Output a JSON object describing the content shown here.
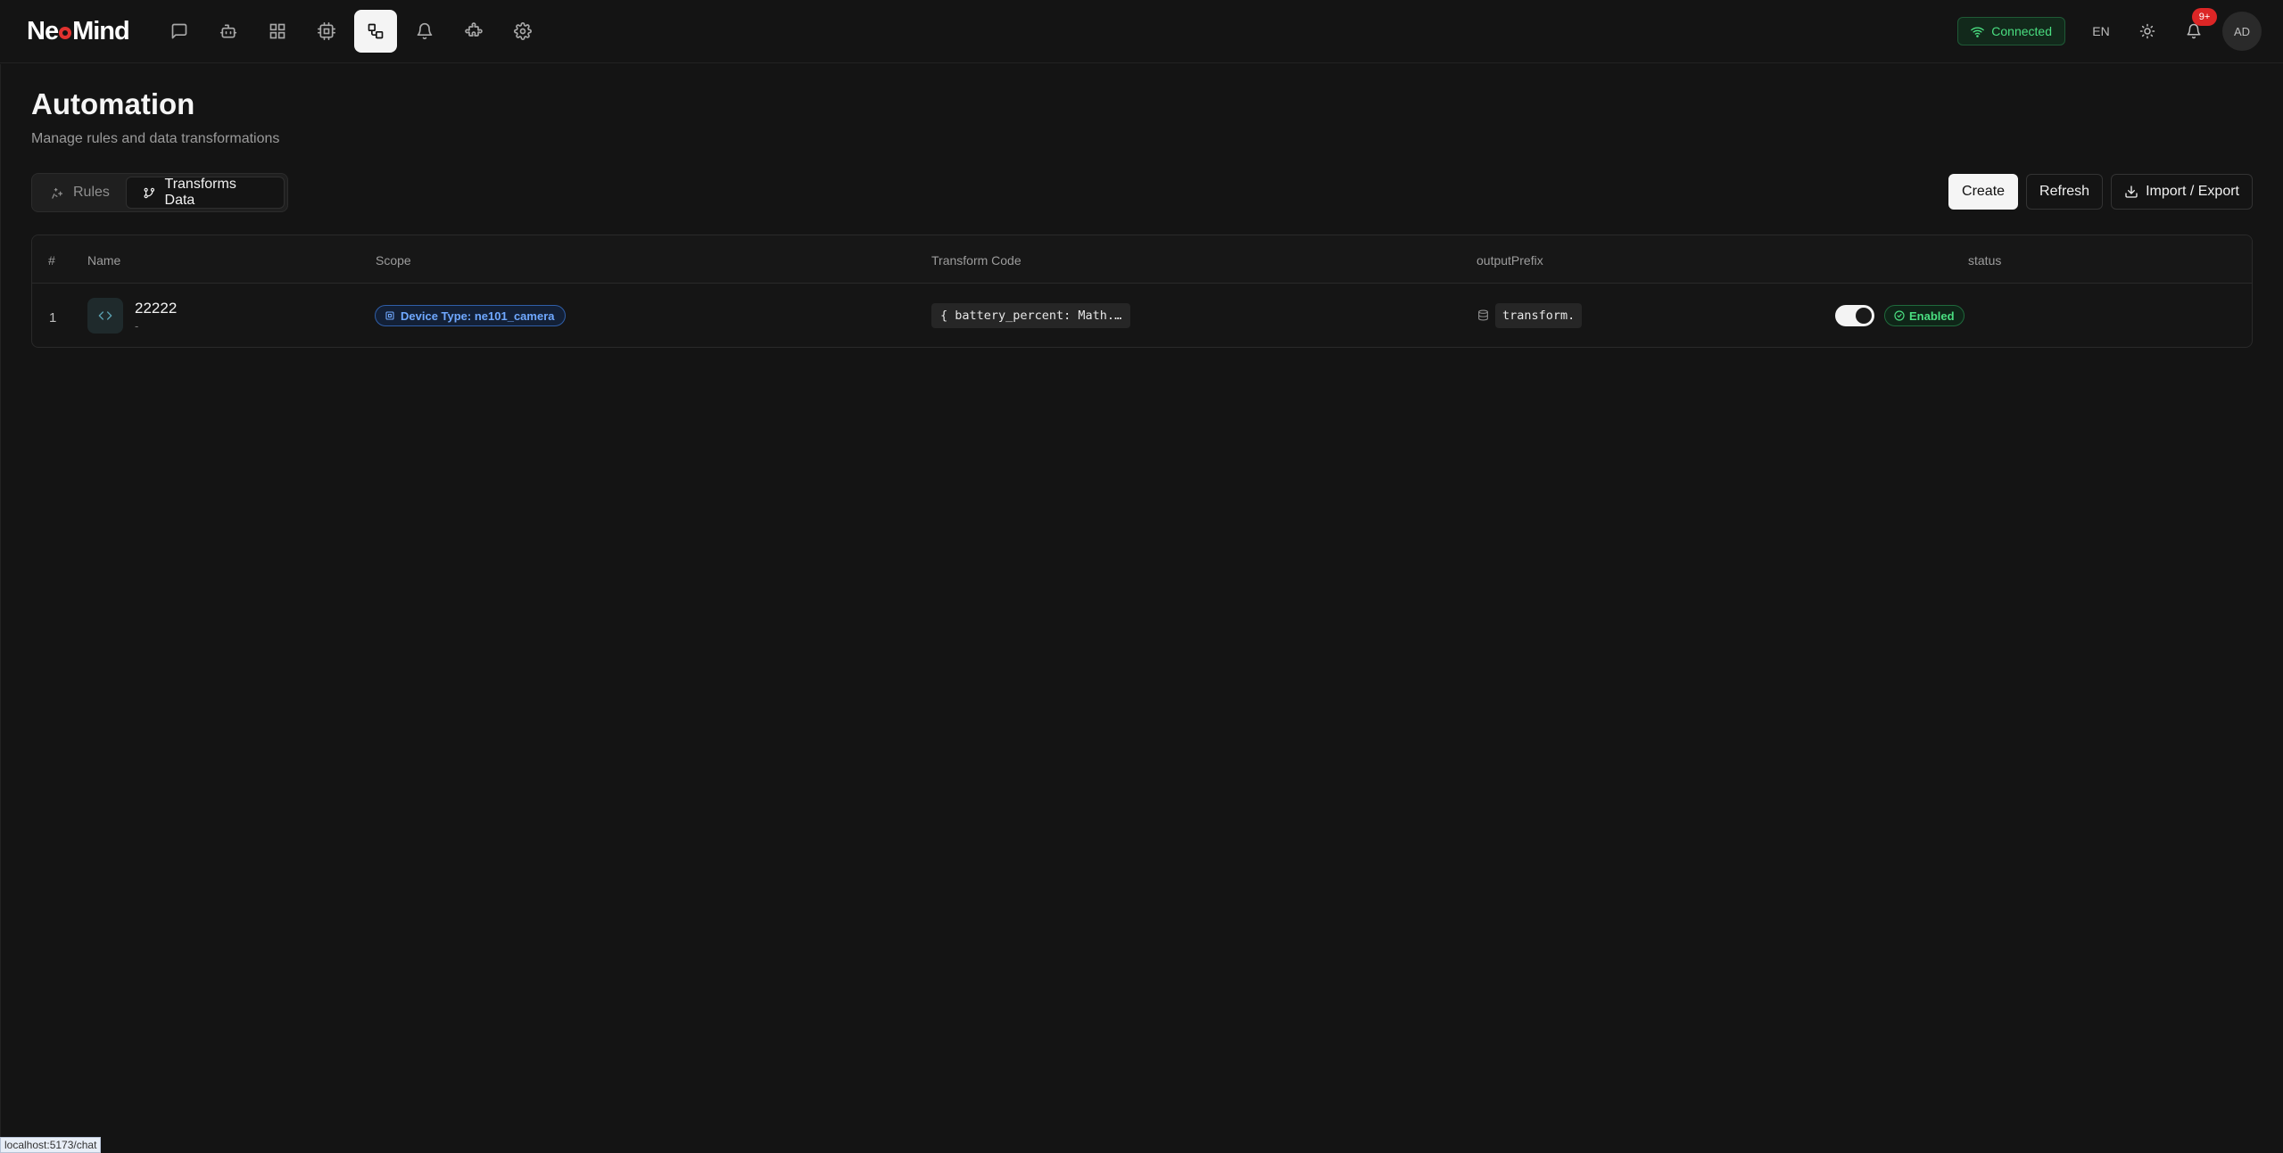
{
  "brand": {
    "logo_left": "Ne",
    "logo_right": "Mind",
    "accent": "#e0322f"
  },
  "nav": {
    "icons": [
      "chat-icon",
      "bot-icon",
      "dashboard-icon",
      "devices-icon",
      "automation-icon",
      "alerts-icon",
      "plugins-icon",
      "settings-icon"
    ],
    "active": "automation-icon"
  },
  "topbar": {
    "connection": "Connected",
    "language": "EN",
    "notifications_badge": "9+",
    "avatar": "AD"
  },
  "page": {
    "title": "Automation",
    "subtitle": "Manage rules and data transformations"
  },
  "tabs": [
    {
      "label": "Rules",
      "active": false
    },
    {
      "label": "Transforms Data",
      "active": true
    }
  ],
  "actions": {
    "create": "Create",
    "refresh": "Refresh",
    "import_export": "Import / Export"
  },
  "table": {
    "columns": [
      "#",
      "Name",
      "Scope",
      "Transform Code",
      "outputPrefix",
      "status"
    ],
    "rows": [
      {
        "num": "1",
        "name": "22222",
        "desc": "-",
        "scope": "Device Type: ne101_camera",
        "code": "{ battery_percent: Math.…",
        "prefix": "transform.",
        "enabled": true,
        "status": "Enabled"
      }
    ]
  },
  "statusbar": {
    "url": "localhost:5173/chat"
  },
  "colors": {
    "bg": "#141414",
    "success": "#4ade80",
    "info": "#6fa8ff",
    "danger": "#dc2626"
  }
}
